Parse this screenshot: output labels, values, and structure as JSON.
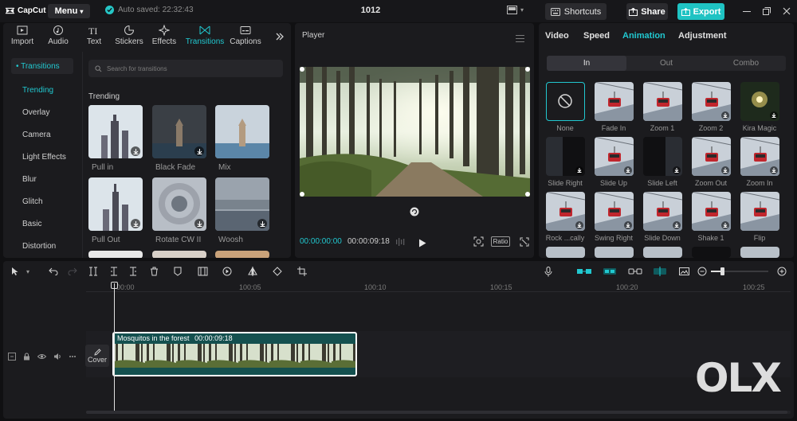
{
  "app": {
    "logo_text": "CapCut",
    "menu_label": "Menu",
    "autosave_text": "Auto saved: 22:32:43",
    "project_title": "1012",
    "shortcuts_label": "Shortcuts",
    "share_label": "Share",
    "export_label": "Export"
  },
  "toolbar": {
    "tools": [
      {
        "label": "Import",
        "icon": "import-icon"
      },
      {
        "label": "Audio",
        "icon": "audio-icon"
      },
      {
        "label": "Text",
        "icon": "text-icon"
      },
      {
        "label": "Stickers",
        "icon": "stickers-icon"
      },
      {
        "label": "Effects",
        "icon": "effects-icon"
      },
      {
        "label": "Transitions",
        "icon": "transitions-icon",
        "active": true
      },
      {
        "label": "Captions",
        "icon": "captions-icon"
      }
    ]
  },
  "sidebar": {
    "header": "• Transitions",
    "items": [
      "Trending",
      "Overlay",
      "Camera",
      "Light Effects",
      "Blur",
      "Glitch",
      "Basic",
      "Distortion"
    ],
    "active_index": 0
  },
  "transitions": {
    "search_placeholder": "Search for transitions",
    "section": "Trending",
    "cards": [
      "Pull in",
      "Black Fade",
      "Mix",
      "Pull Out",
      "Rotate CW II",
      "Woosh"
    ]
  },
  "player": {
    "title": "Player",
    "current_time": "00:00:00:00",
    "duration": "00:00:09:18",
    "ratio_label": "Ratio"
  },
  "inspector": {
    "tabs": [
      "Video",
      "Speed",
      "Animation",
      "Adjustment"
    ],
    "active_tab": "Animation",
    "segments": [
      "In",
      "Out",
      "Combo"
    ],
    "active_segment": "In",
    "animations": [
      "None",
      "Fade In",
      "Zoom 1",
      "Zoom 2",
      "Kira Magic",
      "Slide Right",
      "Slide Up",
      "Slide Left",
      "Zoom Out",
      "Zoom In",
      "Rock ...cally",
      "Swing Right",
      "Slide Down",
      "Shake 1",
      "Flip"
    ]
  },
  "timeline": {
    "ruler": [
      "00:00",
      "100:05",
      "100:10",
      "100:15",
      "100:20",
      "100:25"
    ],
    "cover_label": "Cover",
    "clip_name": "Mosquitos in the forest",
    "clip_duration": "00:00:09:18"
  },
  "watermark": {
    "brand": "OLX"
  },
  "colors": {
    "accent": "#21c8d0",
    "export": "#1fc3c3",
    "panel": "#1b1b1e",
    "background": "#101012",
    "clip": "#14504f"
  }
}
